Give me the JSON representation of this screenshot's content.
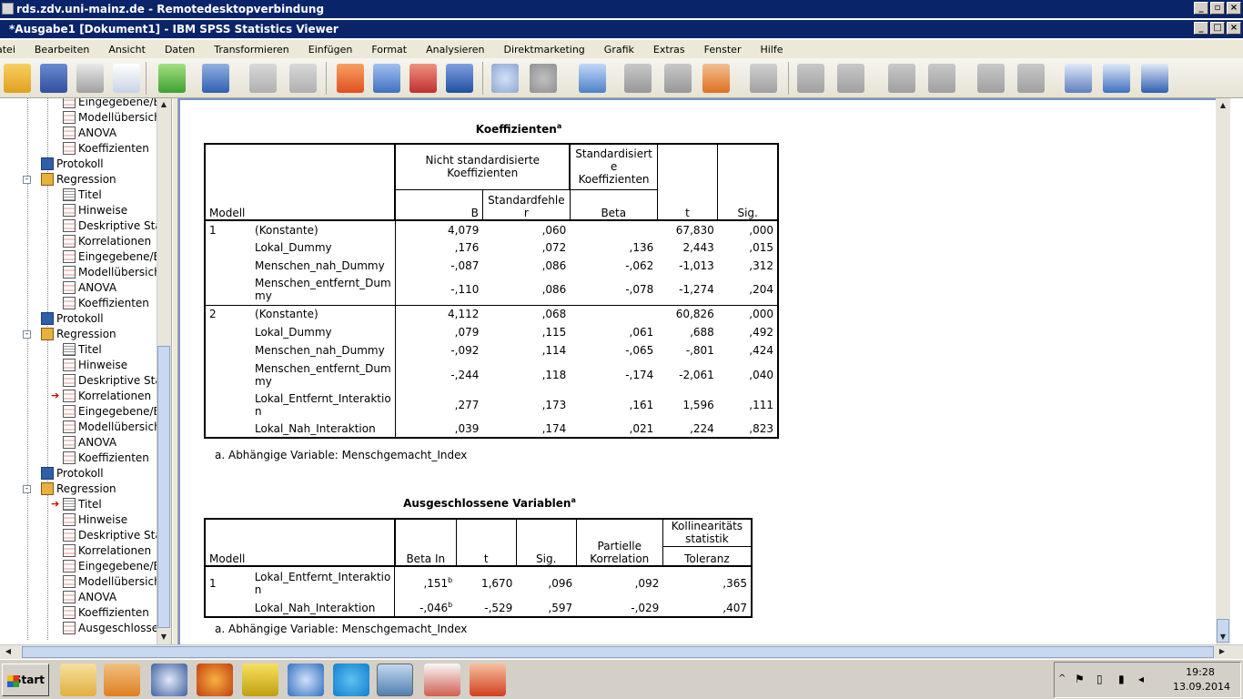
{
  "rdp": {
    "title": "rds.zdv.uni-mainz.de - Remotedesktopverbindung"
  },
  "app": {
    "title": "*Ausgabe1 [Dokument1] - IBM SPSS Statistics Viewer"
  },
  "menu": [
    "atei",
    "Bearbeiten",
    "Ansicht",
    "Daten",
    "Transformieren",
    "Einfügen",
    "Format",
    "Analysieren",
    "Direktmarketing",
    "Grafik",
    "Extras",
    "Fenster",
    "Hilfe"
  ],
  "nav": [
    {
      "label": "Eingegebene/E",
      "icon": "table-icon",
      "indent": 3
    },
    {
      "label": "Modellübersich",
      "icon": "table-icon",
      "indent": 3
    },
    {
      "label": "ANOVA",
      "icon": "table-icon",
      "indent": 3
    },
    {
      "label": "Koeffizienten",
      "icon": "table-icon",
      "indent": 3
    },
    {
      "label": "Protokoll",
      "icon": "log-icon",
      "indent": 2
    },
    {
      "label": "Regression",
      "icon": "regression-icon",
      "indent": 1,
      "expander": "-"
    },
    {
      "label": "Titel",
      "icon": "title-icon",
      "indent": 3
    },
    {
      "label": "Hinweise",
      "icon": "notes-icon",
      "indent": 3
    },
    {
      "label": "Deskriptive Stat",
      "icon": "table-icon",
      "indent": 3
    },
    {
      "label": "Korrelationen",
      "icon": "table-icon",
      "indent": 3
    },
    {
      "label": "Eingegebene/E",
      "icon": "table-icon",
      "indent": 3
    },
    {
      "label": "Modellübersich",
      "icon": "table-icon",
      "indent": 3
    },
    {
      "label": "ANOVA",
      "icon": "table-icon",
      "indent": 3
    },
    {
      "label": "Koeffizienten",
      "icon": "table-icon",
      "indent": 3
    },
    {
      "label": "Protokoll",
      "icon": "log-icon",
      "indent": 2
    },
    {
      "label": "Regression",
      "icon": "regression-icon",
      "indent": 1,
      "expander": "-"
    },
    {
      "label": "Titel",
      "icon": "title-icon",
      "indent": 3
    },
    {
      "label": "Hinweise",
      "icon": "notes-icon",
      "indent": 3
    },
    {
      "label": "Deskriptive Stat",
      "icon": "table-icon",
      "indent": 3
    },
    {
      "label": "Korrelationen",
      "icon": "table-icon",
      "indent": 3,
      "arrow": true
    },
    {
      "label": "Eingegebene/E",
      "icon": "table-icon",
      "indent": 3
    },
    {
      "label": "Modellübersich",
      "icon": "table-icon",
      "indent": 3
    },
    {
      "label": "ANOVA",
      "icon": "table-icon",
      "indent": 3
    },
    {
      "label": "Koeffizienten",
      "icon": "table-icon",
      "indent": 3
    },
    {
      "label": "Protokoll",
      "icon": "log-icon",
      "indent": 2
    },
    {
      "label": "Regression",
      "icon": "regression-icon",
      "indent": 1,
      "expander": "-"
    },
    {
      "label": "Titel",
      "icon": "title-icon",
      "indent": 3,
      "arrow": true
    },
    {
      "label": "Hinweise",
      "icon": "notes-icon",
      "indent": 3
    },
    {
      "label": "Deskriptive Stat",
      "icon": "table-icon",
      "indent": 3
    },
    {
      "label": "Korrelationen",
      "icon": "table-icon",
      "indent": 3
    },
    {
      "label": "Eingegebene/E",
      "icon": "table-icon",
      "indent": 3
    },
    {
      "label": "Modellübersich",
      "icon": "table-icon",
      "indent": 3
    },
    {
      "label": "ANOVA",
      "icon": "table-icon",
      "indent": 3
    },
    {
      "label": "Koeffizienten",
      "icon": "table-icon",
      "indent": 3
    },
    {
      "label": "Ausgeschlosse",
      "icon": "table-icon",
      "indent": 3
    }
  ],
  "coef": {
    "title": "Koeffizienten",
    "title_sup": "a",
    "h_modell": "Modell",
    "h_nonstd": "Nicht standardisierte Koeffizienten",
    "h_std": "Standardisierte Koeffizienten",
    "h_std_lines": [
      "Standardisiert",
      "e",
      "Koeffizienten"
    ],
    "h_b": "B",
    "h_se_lines": [
      "Standardfehle",
      "r"
    ],
    "h_beta": "Beta",
    "h_t": "t",
    "h_sig": "Sig.",
    "rows": [
      {
        "m": "1",
        "var": [
          "(Konstante)"
        ],
        "b": "4,079",
        "se": ",060",
        "beta": "",
        "t": "67,830",
        "sig": ",000"
      },
      {
        "m": "",
        "var": [
          "Lokal_Dummy"
        ],
        "b": ",176",
        "se": ",072",
        "beta": ",136",
        "t": "2,443",
        "sig": ",015"
      },
      {
        "m": "",
        "var": [
          "Menschen_nah_Dummy"
        ],
        "b": "-,087",
        "se": ",086",
        "beta": "-,062",
        "t": "-1,013",
        "sig": ",312"
      },
      {
        "m": "",
        "var": [
          "Menschen_entfernt_Dum",
          "my"
        ],
        "b": "-,110",
        "se": ",086",
        "beta": "-,078",
        "t": "-1,274",
        "sig": ",204"
      },
      {
        "m": "2",
        "var": [
          "(Konstante)"
        ],
        "b": "4,112",
        "se": ",068",
        "beta": "",
        "t": "60,826",
        "sig": ",000"
      },
      {
        "m": "",
        "var": [
          "Lokal_Dummy"
        ],
        "b": ",079",
        "se": ",115",
        "beta": ",061",
        "t": ",688",
        "sig": ",492"
      },
      {
        "m": "",
        "var": [
          "Menschen_nah_Dummy"
        ],
        "b": "-,092",
        "se": ",114",
        "beta": "-,065",
        "t": "-,801",
        "sig": ",424"
      },
      {
        "m": "",
        "var": [
          "Menschen_entfernt_Dum",
          "my"
        ],
        "b": "-,244",
        "se": ",118",
        "beta": "-,174",
        "t": "-2,061",
        "sig": ",040"
      },
      {
        "m": "",
        "var": [
          "Lokal_Entfernt_Interaktio",
          "n"
        ],
        "b": ",277",
        "se": ",173",
        "beta": ",161",
        "t": "1,596",
        "sig": ",111"
      },
      {
        "m": "",
        "var": [
          "Lokal_Nah_Interaktion"
        ],
        "b": ",039",
        "se": ",174",
        "beta": ",021",
        "t": ",224",
        "sig": ",823"
      }
    ],
    "footnote": "a. Abhängige Variable: Menschgemacht_Index"
  },
  "excl": {
    "title": "Ausgeschlossene Variablen",
    "title_sup": "a",
    "h_modell": "Modell",
    "h_betain": "Beta In",
    "h_t": "t",
    "h_sig": "Sig.",
    "h_partial_lines": [
      "Partielle",
      "Korrelation"
    ],
    "h_koll_lines": [
      "Kollinearitäts",
      "statistik"
    ],
    "h_tol": "Toleranz",
    "rows": [
      {
        "m": "1",
        "var": [
          "Lokal_Entfernt_Interaktio",
          "n"
        ],
        "betain": ",151",
        "sup": "b",
        "t": "1,670",
        "sig": ",096",
        "pk": ",092",
        "tol": ",365"
      },
      {
        "m": "",
        "var": [
          "Lokal_Nah_Interaktion"
        ],
        "betain": "-,046",
        "sup": "b",
        "t": "-,529",
        "sig": ",597",
        "pk": "-,029",
        "tol": ",407"
      }
    ],
    "footnote": "a. Abhängige Variable: Menschgemacht_Index"
  },
  "taskbar": {
    "start": "Start",
    "time": "19:28",
    "date": "13.09.2014"
  }
}
